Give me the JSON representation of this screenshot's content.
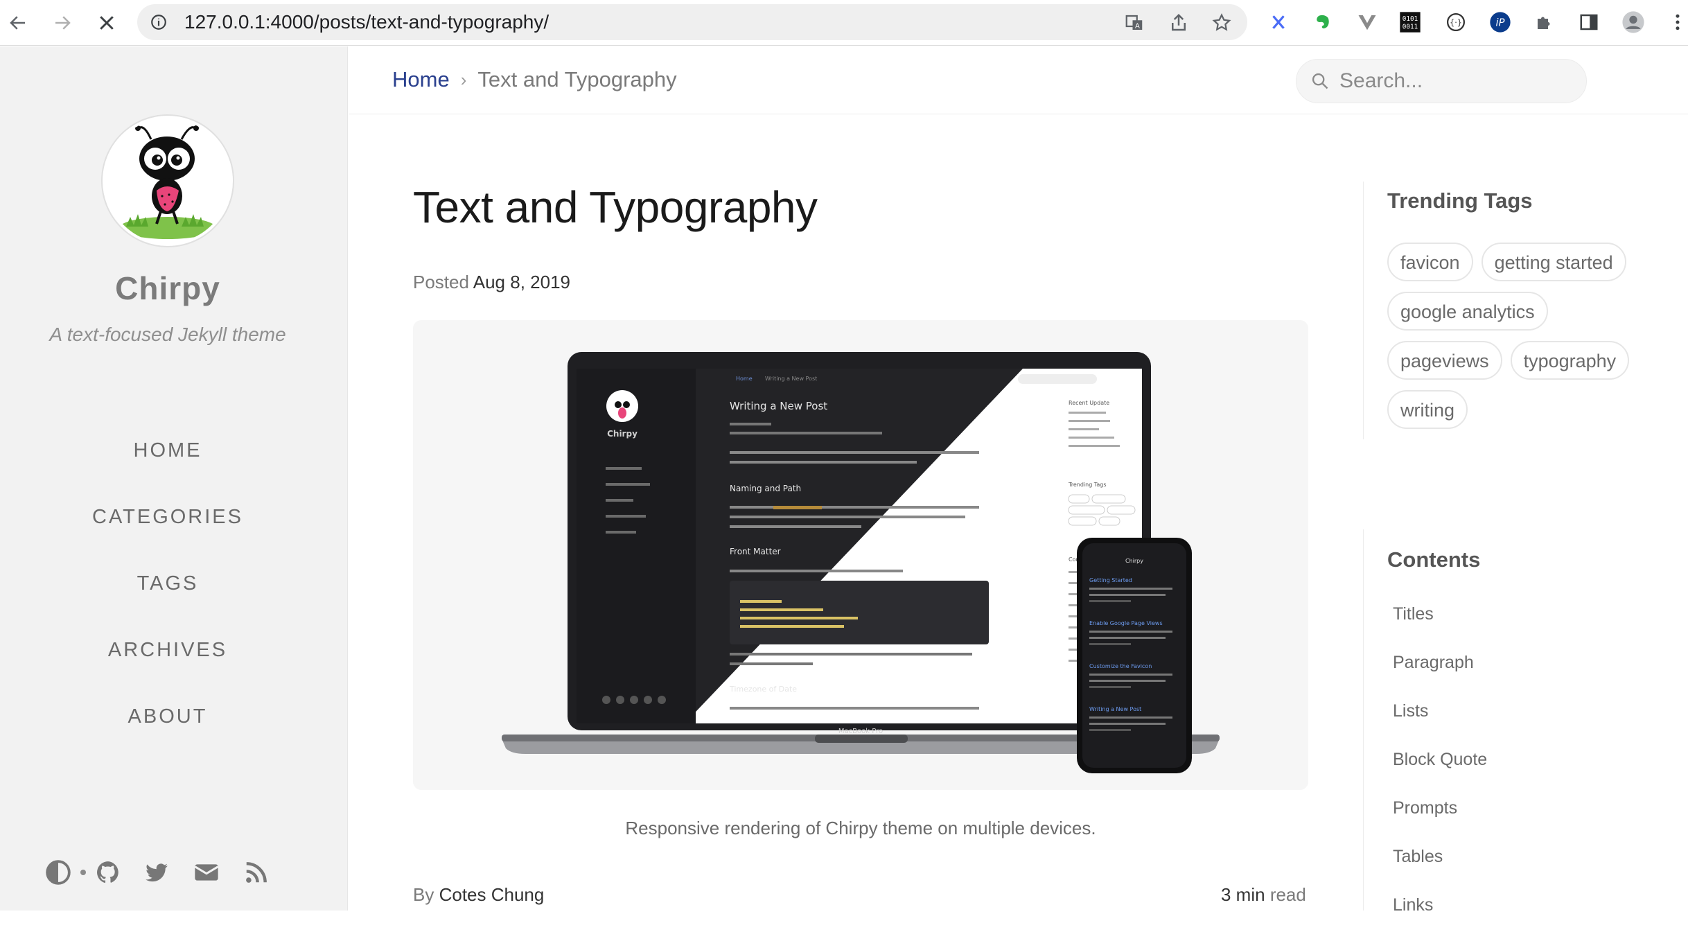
{
  "browser": {
    "url_host": "127.0.0.1",
    "url_path": ":4000/posts/text-and-typography/",
    "loading": true
  },
  "sidebar": {
    "title": "Chirpy",
    "subtitle": "A text-focused Jekyll theme",
    "nav": [
      "HOME",
      "CATEGORIES",
      "TAGS",
      "ARCHIVES",
      "ABOUT"
    ],
    "footer_icons": [
      "theme-toggle-icon",
      "github-icon",
      "twitter-icon",
      "email-icon",
      "rss-icon"
    ]
  },
  "topbar": {
    "breadcrumb_home": "Home",
    "breadcrumb_separator": "›",
    "breadcrumb_current": "Text and Typography",
    "search_placeholder": "Search..."
  },
  "post": {
    "title": "Text and Typography",
    "posted_label": "Posted",
    "date": "Aug 8, 2019",
    "caption": "Responsive rendering of Chirpy theme on multiple devices.",
    "by_label": "By",
    "author": "Cotes Chung",
    "read_minutes": "3 min",
    "read_label": "read"
  },
  "trending": {
    "heading": "Trending Tags",
    "tags": [
      "favicon",
      "getting started",
      "google analytics",
      "pageviews",
      "typography",
      "writing"
    ]
  },
  "toc": {
    "heading": "Contents",
    "items": [
      "Titles",
      "Paragraph",
      "Lists",
      "Block Quote",
      "Prompts",
      "Tables",
      "Links"
    ]
  },
  "mockup": {
    "laptop_label": "MacBook Pro",
    "breadcrumb_home": "Home",
    "breadcrumb_current": "Writing a New Post",
    "post_title": "Writing a New Post",
    "h2a": "Naming and Path",
    "h2b": "Front Matter",
    "h2c": "Timezone of Date",
    "site": "Chirpy",
    "recent_heading": "Recent Update",
    "tags_heading": "Trending Tags",
    "contents_heading": "Contents",
    "phone_title": "Chirpy",
    "phone_posts": [
      "Getting Started",
      "Enable Google Page Views",
      "Customize the Favicon",
      "Writing a New Post"
    ]
  },
  "colors": {
    "accent_link": "#2a408e",
    "sidebar_bg": "#f2f2f2",
    "dark_mockup": "#1b1b1e"
  }
}
